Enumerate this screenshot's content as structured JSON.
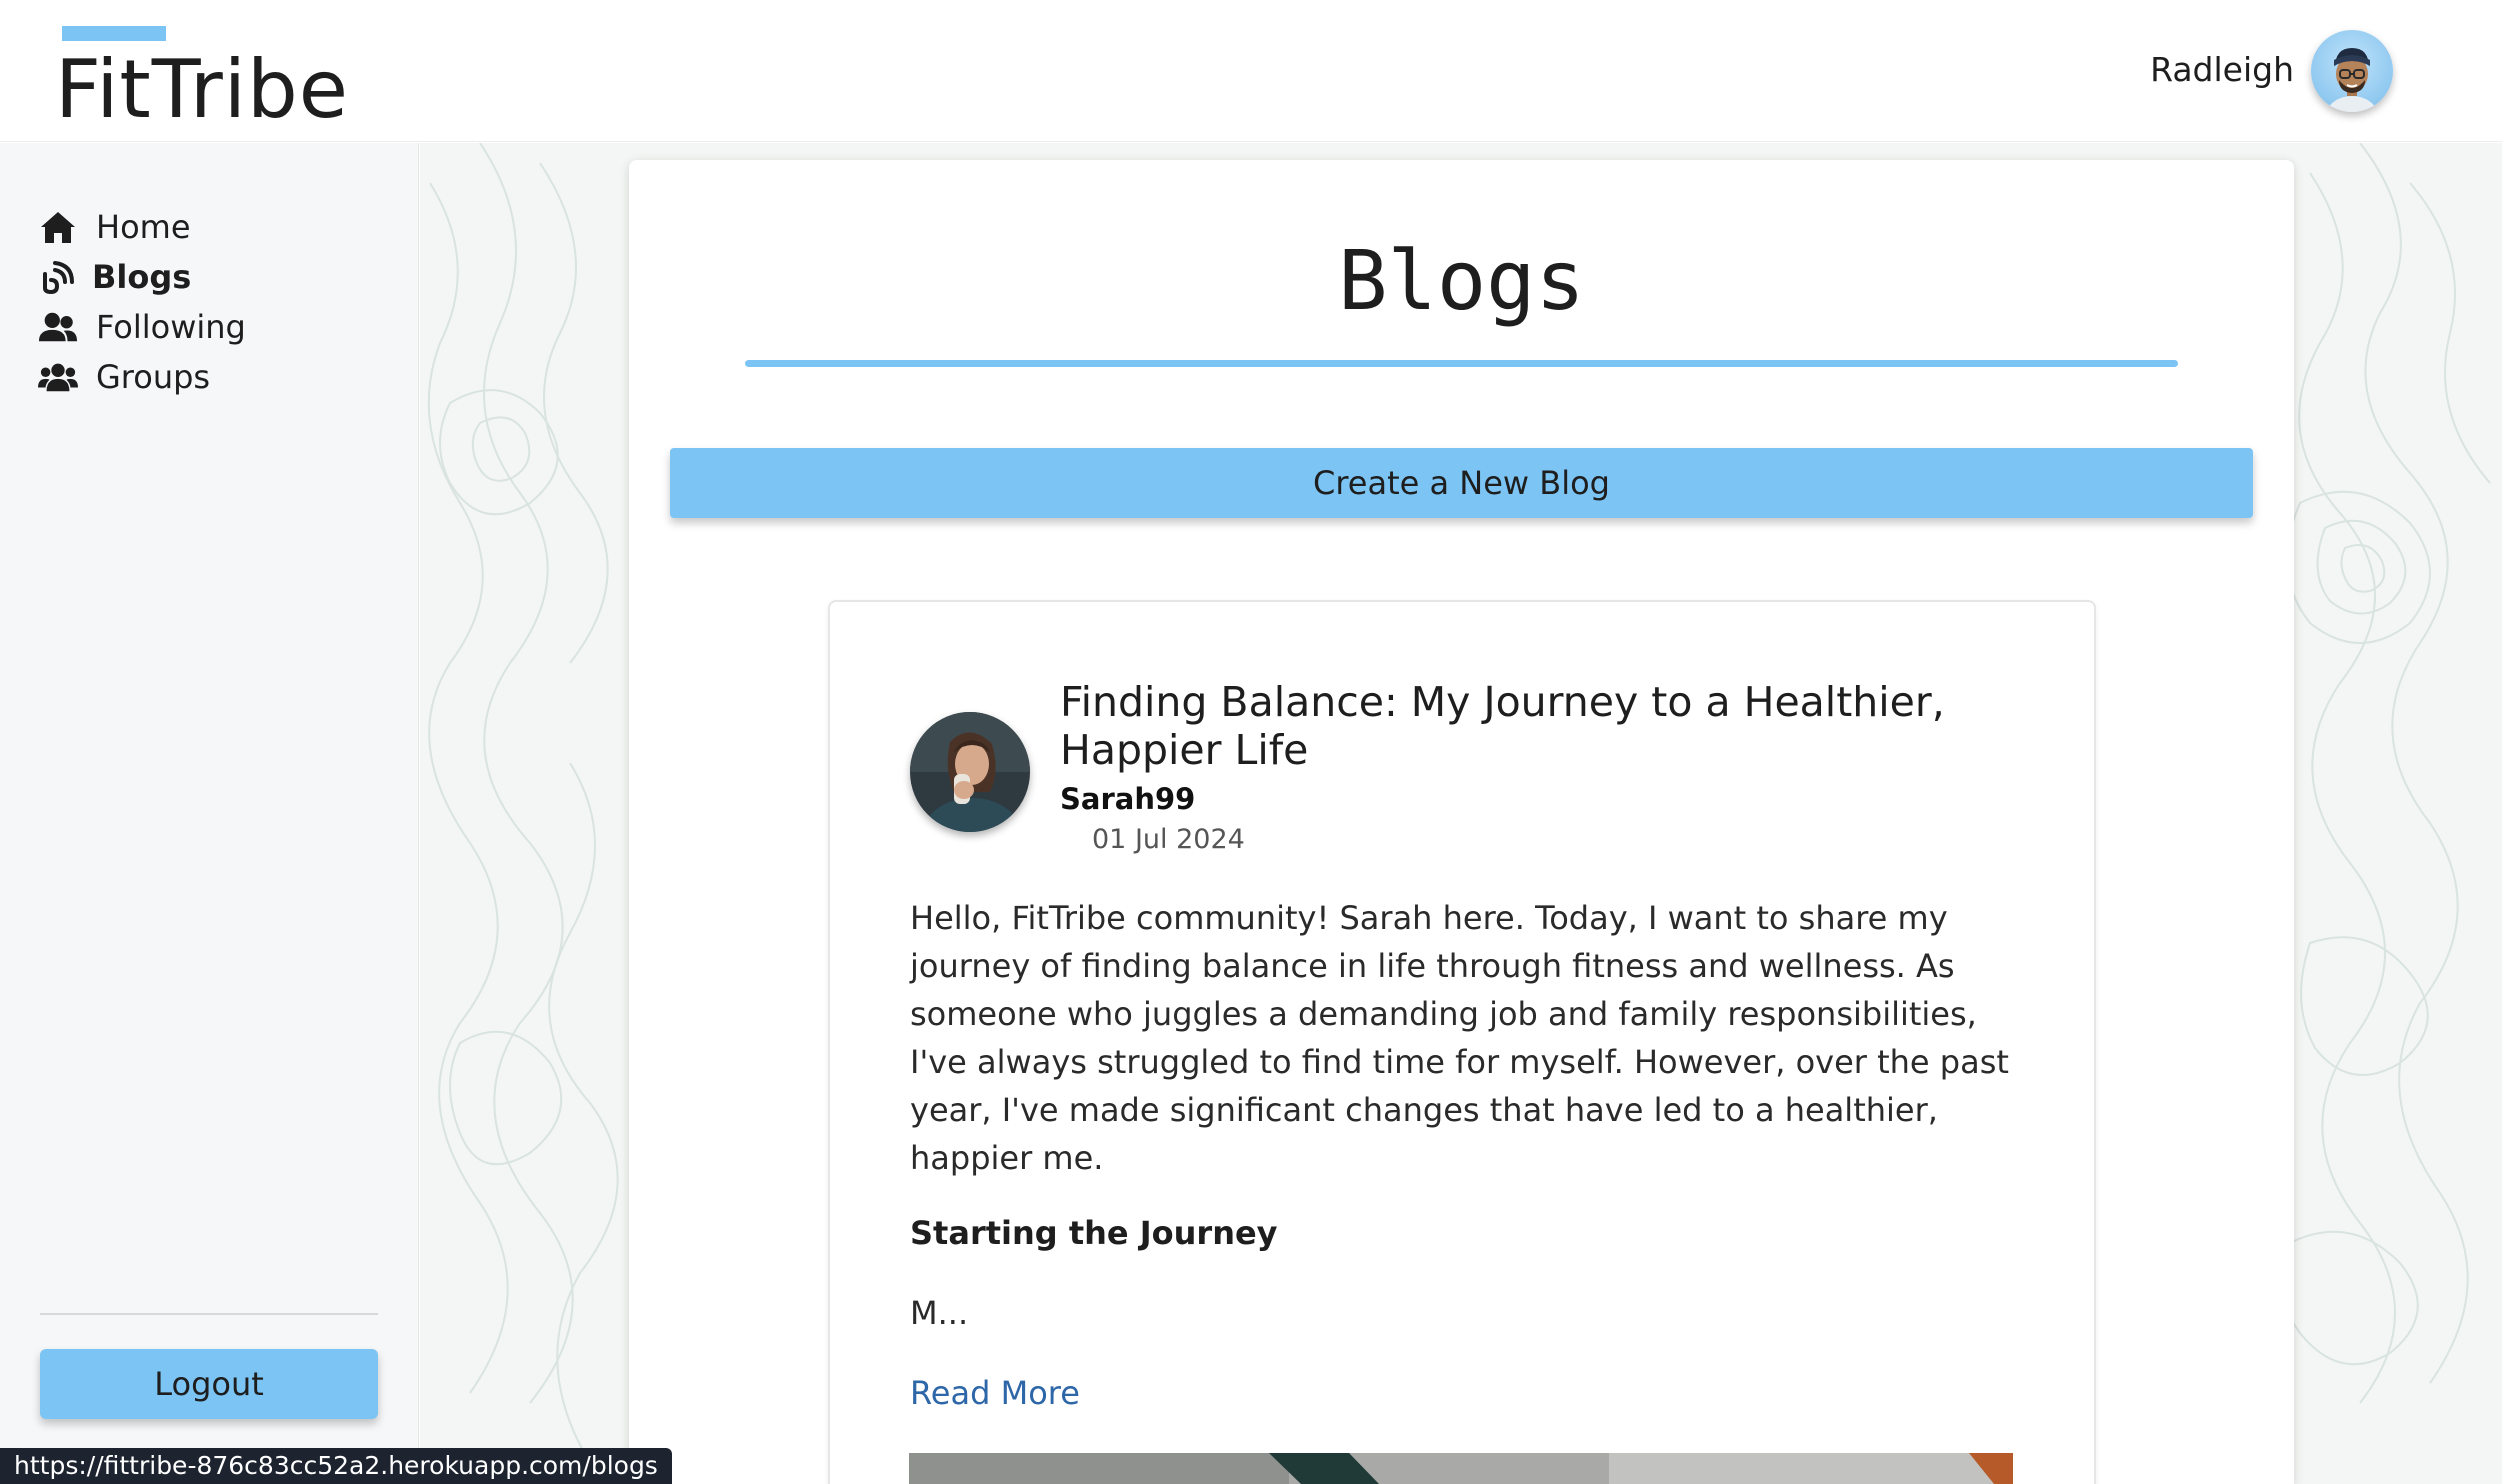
{
  "app": {
    "name": "FitTribe",
    "accent_color": "#7cc4f3"
  },
  "header": {
    "user_name": "Radleigh",
    "avatar_icon": "user-avatar-memoji"
  },
  "sidebar": {
    "items": [
      {
        "label": "Home",
        "icon": "home-icon",
        "active": false
      },
      {
        "label": "Blogs",
        "icon": "blog-rss-icon",
        "active": true
      },
      {
        "label": "Following",
        "icon": "user-friends-icon",
        "active": false
      },
      {
        "label": "Groups",
        "icon": "users-group-icon",
        "active": false
      }
    ],
    "logout_label": "Logout"
  },
  "main": {
    "title": "Blogs",
    "create_label": "Create a New Blog",
    "posts": [
      {
        "title": "Finding Balance: My Journey to a Healthier, Happier Life",
        "author": "Sarah99",
        "date": "01 Jul 2024",
        "excerpt": "Hello, FitTribe community! Sarah here. Today, I want to share my journey of finding balance in life through fitness and wellness. As someone who juggles a demanding job and family responsibilities, I've always struggled to find time for myself. However, over the past year, I've made significant changes that have led to a healthier, happier me.",
        "subheading": "Starting the Journey",
        "truncated": "M...",
        "read_more_label": "Read More"
      }
    ]
  },
  "status_bar": {
    "url": "https://fittribe-876c83cc52a2.herokuapp.com/blogs"
  }
}
